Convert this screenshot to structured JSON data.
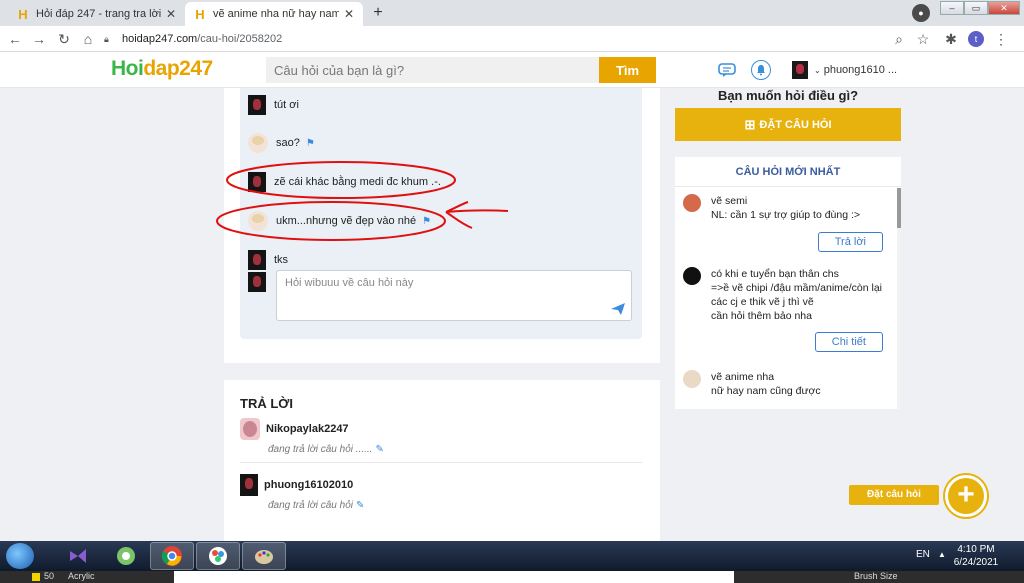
{
  "browser": {
    "tabs": [
      {
        "title": "Hỏi đáp 247 - trang tra lời",
        "active": false
      },
      {
        "title": "vẽ anime nha nữ hay nam cũng được",
        "active": true
      }
    ],
    "url_host": "hoidap247.com",
    "url_path": "/cau-hoi/2058202",
    "profile_initial": "t"
  },
  "site": {
    "logo_part1": "Hoi",
    "logo_part2": "dap247",
    "search_placeholder": "Câu hỏi của bạn là gì?",
    "search_button": "Tìm",
    "username": "phuong1610 ..."
  },
  "comments": [
    {
      "text": "tút ơi",
      "avatar": "dark",
      "flag": false
    },
    {
      "text": "sao?",
      "avatar": "light",
      "flag": true
    },
    {
      "text": "zẽ cái khác bằng medi đc khum .-.",
      "avatar": "dark",
      "flag": false
    },
    {
      "text": "ukm...nhưng vẽ đẹp vào nhé",
      "avatar": "light",
      "flag": true
    },
    {
      "text": "tks",
      "avatar": "dark",
      "flag": false
    }
  ],
  "reply_placeholder": "Hỏi wibuuu về câu hỏi này",
  "answers": {
    "title": "TRẢ LỜI",
    "items": [
      {
        "name": "Nikopaylak2247",
        "status": "đang trả lời câu hỏi ......"
      },
      {
        "name": "phuong16102010",
        "status": "đang trả lời câu hỏi"
      }
    ]
  },
  "sidebar": {
    "ask_heading": "Bạn muốn hỏi điều gì?",
    "ask_button": "ĐẶT CÂU HỎI",
    "latest_title": "CÂU HỎI MỚI NHẤT",
    "questions": [
      {
        "text": "vẽ semi\nNL: cần 1 sự trợ giúp to đùng :>",
        "button": "Trả lời"
      },
      {
        "text": "có khi e tuyển bạn thân chs\n=>ề vẽ chipi /đậu mầm/anime/còn lại các cj e thik vẽ j thì vẽ\ncần hỏi thêm bảo nha",
        "button": "Chi tiết"
      },
      {
        "text": "vẽ anime nha\nnữ hay nam cũng được",
        "button": ""
      }
    ]
  },
  "fab": {
    "label": "Đặt câu hỏi",
    "symbol": "+"
  },
  "taskbar": {
    "lang": "EN",
    "time": "4:10 PM",
    "date": "6/24/2021"
  },
  "bottom_strip": {
    "zoom": "50",
    "layer": "Acrylic",
    "brush": "Brush Size"
  },
  "colors": {
    "accent": "#e8a400",
    "brand_green": "#39b54a",
    "link_blue": "#3b7bd0",
    "annotation_red": "#e01010"
  }
}
